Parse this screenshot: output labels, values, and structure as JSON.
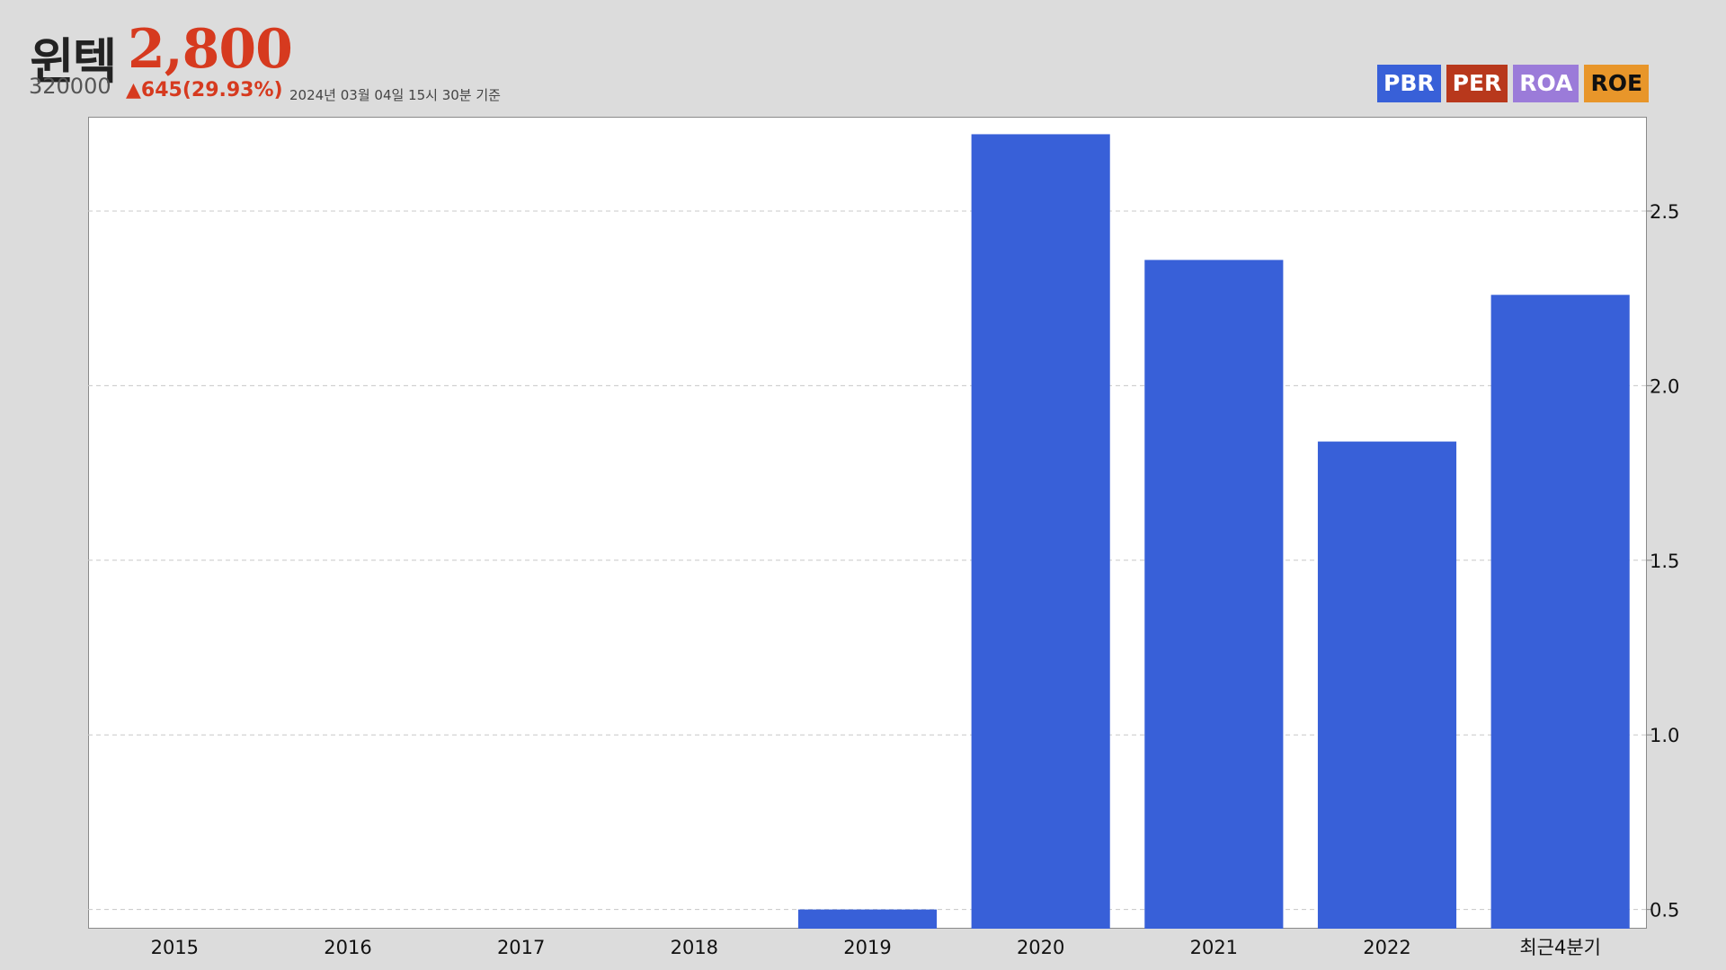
{
  "header": {
    "name": "윈텍",
    "price": "2,800",
    "code": "320000",
    "change": "▲645(29.93%)",
    "as_of": "2024년 03월 04일 15시 30분 기준"
  },
  "legend": [
    {
      "label": "PBR",
      "color": "#3860d8"
    },
    {
      "label": "PER",
      "color": "#b8381c"
    },
    {
      "label": "ROA",
      "color": "#9b7bd9",
      "text_color": "#ffffff"
    },
    {
      "label": "ROE",
      "color": "#e8962a",
      "text_color": "#111111"
    }
  ],
  "chart_data": {
    "type": "bar",
    "categories": [
      "2015",
      "2016",
      "2017",
      "2018",
      "2019",
      "2020",
      "2021",
      "2022",
      "최근4분기"
    ],
    "series": [
      {
        "values": [
          null,
          null,
          null,
          null,
          0.5,
          2.72,
          2.36,
          1.84,
          2.26
        ],
        "color": "#3860d8"
      }
    ],
    "ylim": [
      0.445,
      2.77
    ],
    "yticks": [
      "0.5",
      "1.0",
      "1.5",
      "2.0",
      "2.5"
    ],
    "y_axis_side": "right",
    "grid": true
  }
}
